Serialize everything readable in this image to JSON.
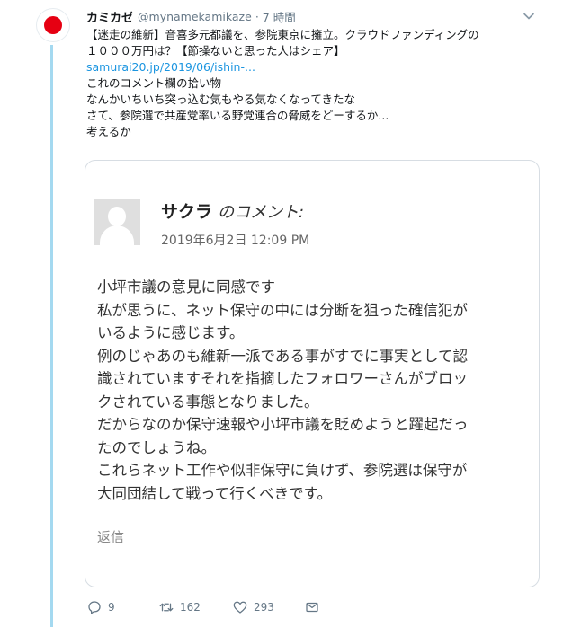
{
  "tweet": {
    "display_name": "カミカゼ",
    "handle": "@mynamekamikaze",
    "separator": "·",
    "time": "7 時間",
    "lines": [
      "【迷走の維新】音喜多元都議を、参院東京に擁立。クラウドファンディングの",
      "１０００万円は？【節操ないと思った人はシェア】"
    ],
    "link": "samurai20.jp/2019/06/ishin-...",
    "comment_lines": [
      "これのコメント欄の拾い物",
      "なんかいちいち突っ込む気もやる気なくなってきたな",
      "さて、参院選で共産党率いる野党連合の脅威をどーするか...",
      "考えるか"
    ]
  },
  "card": {
    "author_name": "サクラ",
    "author_suffix": "のコメント:",
    "date": "2019年6月2日 12:09 PM",
    "body_lines": [
      "小坪市議の意見に同感です",
      "私が思うに、ネット保守の中には分断を狙った確信犯が",
      "いるように感じます。",
      "例のじゃあのも維新一派である事がすでに事実として認",
      "識されていますそれを指摘したフォロワーさんがブロッ",
      "クされている事態となりました。",
      "だからなのか保守速報や小坪市議を貶めようと躍起だっ",
      "たのでしょうね。",
      "これらネット工作や似非保守に負けず、参院選は保守が",
      "大同団結して戦って行くべきです。"
    ],
    "reply_label": "返信"
  },
  "actions": {
    "reply_count": "9",
    "retweet_count": "162",
    "like_count": "293"
  },
  "icons": {
    "avatar": "rising-sun-flag",
    "more": "chevron-down-icon",
    "reply": "reply-icon",
    "retweet": "retweet-icon",
    "like": "heart-icon",
    "dm": "envelope-icon"
  },
  "colors": {
    "link": "#1b95e0",
    "thread_line": "#a4d9f0",
    "flag_red": "#e60012",
    "muted": "#657786"
  }
}
